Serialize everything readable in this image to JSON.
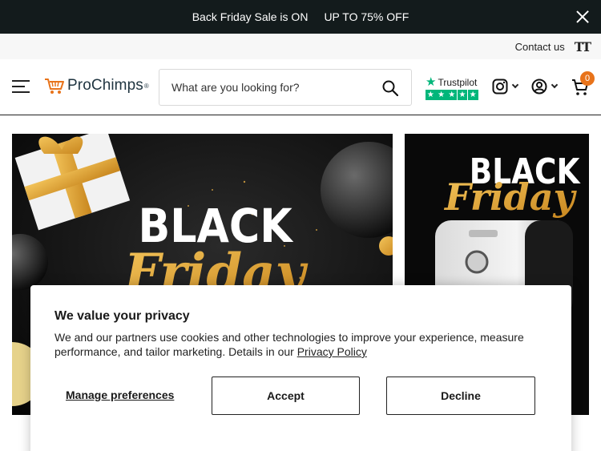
{
  "announcement": {
    "sale_text": "Back Friday Sale is ON",
    "discount_text": "UP TO 75% OFF"
  },
  "utility": {
    "contact": "Contact us",
    "text_size_glyph": "TT"
  },
  "header": {
    "logo_name": "ProChimps",
    "logo_reg": "®",
    "search_placeholder": "What are you looking for?",
    "trustpilot_label": "Trustpilot",
    "trustpilot_stars": 5,
    "cart_count": "0",
    "icons": [
      "menu-icon",
      "search-icon",
      "instagram-icon",
      "account-icon",
      "cart-icon"
    ]
  },
  "banners": {
    "left": {
      "line1": "BLACK",
      "line2": "Friday"
    },
    "right": {
      "line1": "BLACK",
      "line2": "Friday"
    }
  },
  "cookie": {
    "title": "We value your privacy",
    "body": "We and our partners use cookies and other technologies to improve your experience, measure performance, and tailor marketing. Details in our ",
    "policy_link": "Privacy Policy",
    "manage": "Manage preferences",
    "accept": "Accept",
    "decline": "Decline"
  },
  "colors": {
    "announce_bg": "#131b1c",
    "accent_orange": "#e8731a",
    "trustpilot_green": "#00b67a",
    "gold": "#e0a23a"
  }
}
